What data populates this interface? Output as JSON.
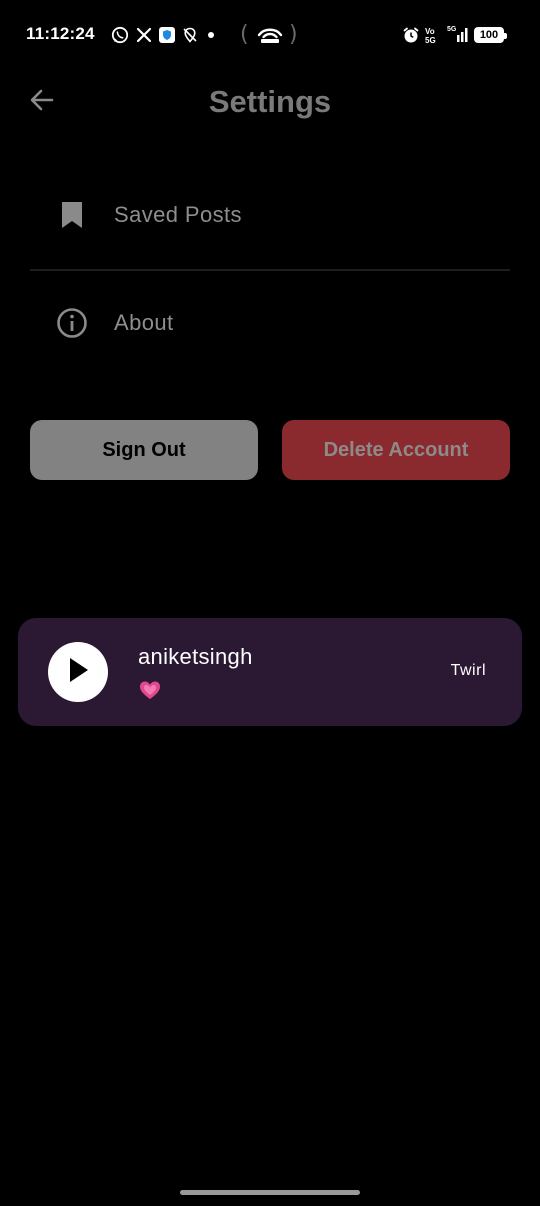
{
  "status_bar": {
    "time": "11:12:24",
    "battery": "100",
    "icons": [
      "whatsapp-icon",
      "x-icon",
      "shield-app-icon",
      "location-off-icon",
      "dot",
      "hotspot-icon",
      "alarm-icon",
      "volte-icon",
      "signal-5g-icon",
      "battery-icon"
    ],
    "network_label": "5G",
    "volte_label_top": "Vo",
    "volte_label_bottom": "5G"
  },
  "header": {
    "title": "Settings",
    "back_icon": "arrow-left-icon"
  },
  "menu": [
    {
      "label": "Saved Posts",
      "icon": "bookmark-icon"
    },
    {
      "label": "About",
      "icon": "info-icon"
    }
  ],
  "actions": {
    "sign_out": "Sign Out",
    "delete_account": "Delete Account"
  },
  "player": {
    "title": "aniketsingh",
    "emoji": "💗",
    "effect_label": "Twirl",
    "play_icon": "play-icon"
  },
  "colors": {
    "background": "#000000",
    "title": "#7a7a7a",
    "menu_text": "#8e8e8e",
    "sign_out_bg": "#828282",
    "delete_bg": "#8a2a2e",
    "player_bg": "#2b1934"
  }
}
